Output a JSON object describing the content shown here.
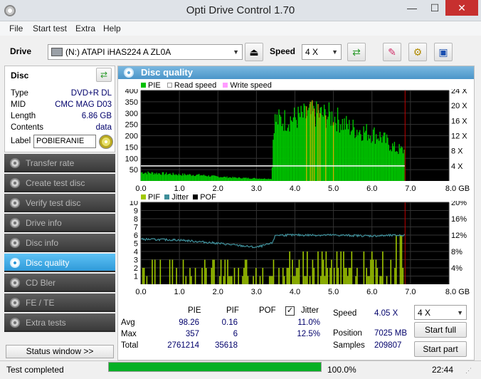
{
  "window": {
    "title": "Opti Drive Control 1.70",
    "minimize": "—",
    "maximize": "☐",
    "close": "✕"
  },
  "menu": [
    "File",
    "Start test",
    "Extra",
    "Help"
  ],
  "toolbar": {
    "drive_label": "Drive",
    "drive_value": "(N:)   ATAPI iHAS224   A ZL0A",
    "speed_label": "Speed",
    "speed_value": "4 X"
  },
  "disc": {
    "title": "Disc",
    "rows": [
      {
        "k": "Type",
        "v": "DVD+R DL"
      },
      {
        "k": "MID",
        "v": "CMC MAG D03"
      },
      {
        "k": "Length",
        "v": "6.86 GB"
      },
      {
        "k": "Contents",
        "v": "data"
      }
    ],
    "label_key": "Label",
    "label_value": "POBIERANIE"
  },
  "nav": [
    {
      "label": "Transfer rate",
      "active": false
    },
    {
      "label": "Create test disc",
      "active": false
    },
    {
      "label": "Verify test disc",
      "active": false
    },
    {
      "label": "Drive info",
      "active": false
    },
    {
      "label": "Disc info",
      "active": false
    },
    {
      "label": "Disc quality",
      "active": true
    },
    {
      "label": "CD Bler",
      "active": false
    },
    {
      "label": "FE / TE",
      "active": false
    },
    {
      "label": "Extra tests",
      "active": false
    }
  ],
  "status_window_button": "Status window >>",
  "panel_title": "Disc quality",
  "chart_data": [
    {
      "type": "area",
      "legend": [
        "PIE",
        "Read speed",
        "Write speed"
      ],
      "x_ticks": [
        "0.0",
        "1.0",
        "2.0",
        "3.0",
        "4.0",
        "5.0",
        "6.0",
        "7.0",
        "8.0 GB"
      ],
      "y_left_ticks": [
        "400",
        "350",
        "300",
        "250",
        "200",
        "150",
        "100",
        "50"
      ],
      "y_right_ticks": [
        "24 X",
        "20 X",
        "16 X",
        "12 X",
        "8 X",
        "4 X"
      ],
      "ylim": [
        0,
        400
      ],
      "xlim": [
        0,
        8
      ],
      "pie_profile": [
        [
          0,
          40
        ],
        [
          0.5,
          35
        ],
        [
          1.0,
          30
        ],
        [
          1.5,
          28
        ],
        [
          2.0,
          20
        ],
        [
          2.5,
          15
        ],
        [
          3.0,
          12
        ],
        [
          3.4,
          10
        ],
        [
          3.45,
          280
        ],
        [
          3.8,
          285
        ],
        [
          4.2,
          300
        ],
        [
          4.6,
          310
        ],
        [
          5.0,
          300
        ],
        [
          5.4,
          250
        ],
        [
          5.8,
          230
        ],
        [
          6.2,
          210
        ],
        [
          6.6,
          150
        ],
        [
          6.86,
          140
        ]
      ],
      "read_speed_x": 4.0,
      "read_speed_range": [
        0,
        3.4
      ],
      "colors": {
        "pie": "#00c000",
        "read": "#ffffff",
        "write": "#ff9cff",
        "spike": "#e0b000",
        "end": "#c00000"
      }
    },
    {
      "type": "bar",
      "legend": [
        "PIF",
        "Jitter",
        "POF"
      ],
      "x_ticks": [
        "0.0",
        "1.0",
        "2.0",
        "3.0",
        "4.0",
        "5.0",
        "6.0",
        "7.0",
        "8.0 GB"
      ],
      "y_left_ticks": [
        "10",
        "9",
        "8",
        "7",
        "6",
        "5",
        "4",
        "3",
        "2",
        "1"
      ],
      "y_right_ticks": [
        "20%",
        "16%",
        "12%",
        "8%",
        "4%"
      ],
      "ylim": [
        0,
        10
      ],
      "xlim": [
        0,
        8
      ],
      "jitter_profile": [
        [
          0,
          11.0
        ],
        [
          1.0,
          10.8
        ],
        [
          2.0,
          10.0
        ],
        [
          3.0,
          9.0
        ],
        [
          3.4,
          10.0
        ],
        [
          3.5,
          12.0
        ],
        [
          5.0,
          12.0
        ],
        [
          6.0,
          11.8
        ],
        [
          6.86,
          12.0
        ]
      ],
      "colors": {
        "pif": "#a0c800",
        "jitter": "#3f8f9a",
        "pof": "#000000"
      }
    }
  ],
  "stats": {
    "headers": [
      "PIE",
      "PIF",
      "POF",
      "Jitter"
    ],
    "rows": [
      {
        "label": "Avg",
        "pie": "98.26",
        "pif": "0.16",
        "pof": "",
        "jitter": "11.0%"
      },
      {
        "label": "Max",
        "pie": "357",
        "pif": "6",
        "pof": "",
        "jitter": "12.5%"
      },
      {
        "label": "Total",
        "pie": "2761214",
        "pif": "35618",
        "pof": "",
        "jitter": ""
      }
    ],
    "speed_label": "Speed",
    "speed_value": "4.05 X",
    "position_label": "Position",
    "position_value": "7025 MB",
    "samples_label": "Samples",
    "samples_value": "209807",
    "speed_select": "4 X",
    "start_full": "Start full",
    "start_part": "Start part"
  },
  "status": {
    "text": "Test completed",
    "progress_percent": 100.0,
    "progress_label": "100.0%",
    "time": "22:44"
  }
}
